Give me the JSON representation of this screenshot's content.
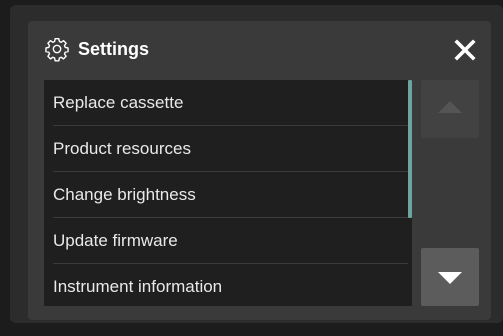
{
  "dialog": {
    "title": "Settings",
    "header_icon": "gear-icon",
    "close_icon": "close-icon"
  },
  "menu": {
    "items": [
      {
        "label": "Replace cassette"
      },
      {
        "label": "Product resources"
      },
      {
        "label": "Change brightness"
      },
      {
        "label": "Update firmware"
      },
      {
        "label": "Instrument information"
      }
    ]
  },
  "scroll": {
    "up_icon": "triangle-up-icon",
    "down_icon": "triangle-down-icon",
    "up_enabled": false,
    "down_enabled": true,
    "scroll_position": 0.0,
    "visible_fraction": 0.61
  },
  "colors": {
    "background": "#1c1c1c",
    "dialog": "#3a3a3a",
    "list": "#1f1f1f",
    "accent": "#6aa5a0",
    "text": "#e9e9e9"
  }
}
